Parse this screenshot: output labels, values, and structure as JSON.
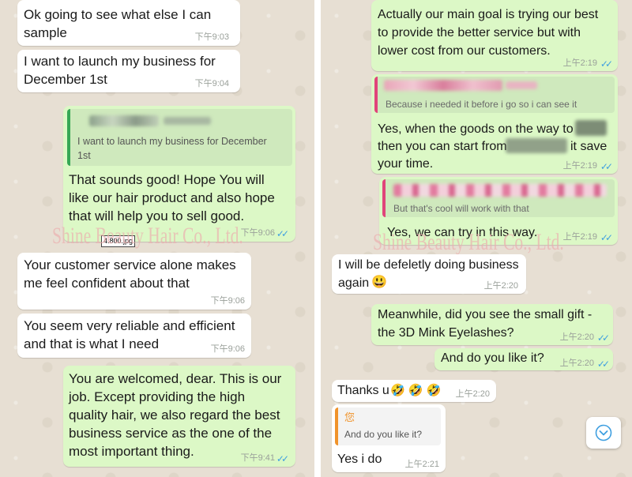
{
  "left": {
    "messages": [
      {
        "text": "Ok going to see what else I can\nsample",
        "time": "下午9:03"
      },
      {
        "text": "I want to launch my business for\nDecember 1st",
        "time": "下午9:04"
      },
      {
        "quote": "I want to launch my business for December\n1st",
        "text": "That sounds good!  Hope You will\nlike our hair product and also hope\nthat will help you to sell good.",
        "time": "下午9:06"
      },
      {
        "text": "Your customer service alone makes\nme feel confident about that",
        "time": "下午9:06"
      },
      {
        "text": "You seem very reliable and efficient\nand that is what I need",
        "time": "下午9:06"
      },
      {
        "text": "You are welcomed, dear. This is our\njob. Except providing the high\nquality hair, we also regard the best\nbusiness service as the one of the\nmost important thing.",
        "time": "下午9:41"
      }
    ],
    "file_tooltip": "4.800.jpg",
    "watermark": "Shine Beauty Hair Co., Ltd."
  },
  "right": {
    "messages": [
      {
        "text": "Actually our main goal is trying our best\nto provide the better service but with\nlower cost from our customers.",
        "time": "上午2:19"
      },
      {
        "quote": "Because i needed it before i go so i can see it",
        "text_1": "Yes, when the goods on the way to",
        "text_2": "then you can start from",
        "text_3": "it save",
        "text_4": "your time.",
        "time": "上午2:19"
      },
      {
        "quote": "But that's  cool will work with that",
        "text": "Yes, we can try in this way.",
        "time": "上午2:19"
      },
      {
        "text": "I will be defeletly doing business\nagain",
        "emoji": "😃",
        "time": "上午2:20"
      },
      {
        "text": "Meanwhile, did you see the small gift -\nthe 3D Mink Eyelashes?",
        "time": "上午2:20"
      },
      {
        "text": "And do you like it?",
        "time": "上午2:20"
      },
      {
        "text": "Thanks u",
        "emoji": "🤣 🤣 🤣",
        "time": "上午2:20"
      },
      {
        "quote_author": "您",
        "quote": "And do you like it?",
        "text": "Yes i do",
        "time": "上午2:21"
      }
    ],
    "watermark": "Shine Beauty Hair Co., Ltd."
  },
  "icons": {
    "read_ticks": "double-check-icon",
    "scroll": "chevron-down-icon"
  },
  "colors": {
    "incoming": "#ffffff",
    "outgoing": "#dcf8c6",
    "tick": "#3f9fe0",
    "watermark": "#ebafaf"
  }
}
